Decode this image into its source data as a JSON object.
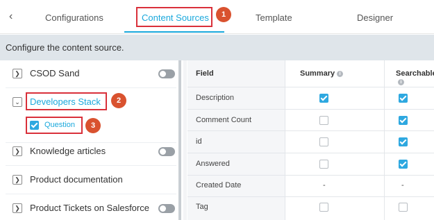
{
  "tabs": {
    "back_icon": "chevron-left-icon",
    "items": [
      "Configurations",
      "Content Sources",
      "Template",
      "Designer"
    ],
    "active": "Content Sources"
  },
  "banner": {
    "text": "Configure the content source."
  },
  "sources": {
    "items": [
      {
        "label": "CSOD Sand",
        "toggle": "off"
      },
      {
        "label": "Developers Stack",
        "expanded": true
      },
      {
        "label": "Question",
        "checked": true
      },
      {
        "label": "Knowledge articles",
        "toggle": "off"
      },
      {
        "label": "Product documentation"
      },
      {
        "label": "Product Tickets on Salesforce",
        "toggle": "off"
      }
    ]
  },
  "table": {
    "headers": [
      "Field",
      "Summary",
      "Searchable"
    ],
    "info_icon": "info-icon",
    "rows": [
      {
        "field": "Description",
        "summary": "checked",
        "searchable": "checked"
      },
      {
        "field": "Comment Count",
        "summary": "unchecked",
        "searchable": "checked"
      },
      {
        "field": "id",
        "summary": "unchecked",
        "searchable": "checked"
      },
      {
        "field": "Answered",
        "summary": "unchecked",
        "searchable": "checked"
      },
      {
        "field": "Created Date",
        "summary": "-",
        "searchable": "-"
      },
      {
        "field": "Tag",
        "summary": "unchecked",
        "searchable": "unchecked"
      }
    ]
  },
  "annotations": [
    "1",
    "2",
    "3"
  ],
  "colors": {
    "accent": "#1aa8dc",
    "annotation": "#d9303a",
    "badge": "#d9522f"
  }
}
